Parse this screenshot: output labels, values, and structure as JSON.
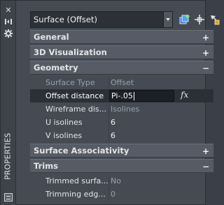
{
  "panel": {
    "title": "PROPERTIES"
  },
  "toolbar": {
    "object_type": "Surface (Offset)"
  },
  "sections": {
    "general": {
      "label": "General",
      "toggle": "+"
    },
    "visualization": {
      "label": "3D Visualization",
      "toggle": "+"
    },
    "geometry": {
      "label": "Geometry",
      "toggle": "−",
      "rows": [
        {
          "label": "Surface Type",
          "value": "Offset"
        },
        {
          "label": "Offset distance",
          "value": "Pi-.05"
        },
        {
          "label": "Wireframe dis...",
          "value": "Isolines"
        },
        {
          "label": "U isolines",
          "value": "6"
        },
        {
          "label": "V isolines",
          "value": "6"
        }
      ],
      "fx_label": "fx"
    },
    "associativity": {
      "label": "Surface Associativity",
      "toggle": "+"
    },
    "trims": {
      "label": "Trims",
      "toggle": "−",
      "rows": [
        {
          "label": "Trimmed surfa...",
          "value": "No"
        },
        {
          "label": "Trimming edg...",
          "value": "0"
        }
      ]
    }
  }
}
